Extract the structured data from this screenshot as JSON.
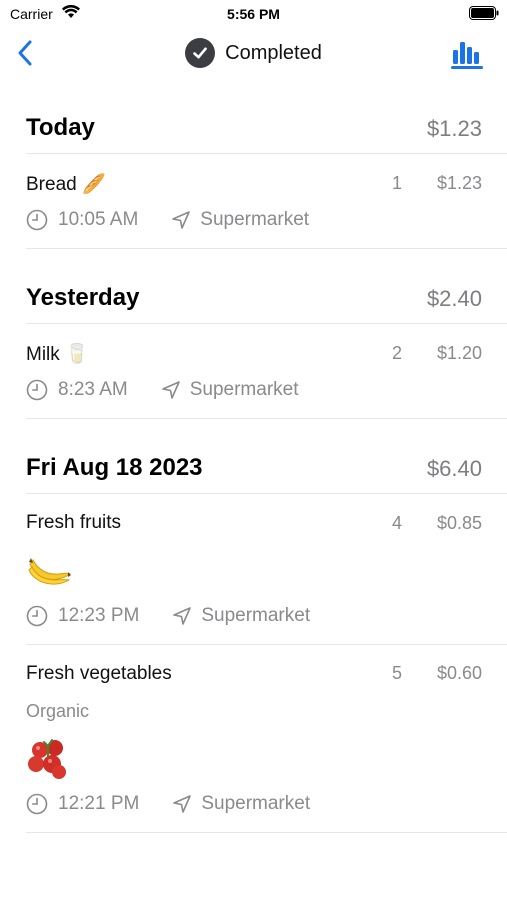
{
  "status": {
    "carrier": "Carrier",
    "time": "5:56 PM"
  },
  "nav": {
    "title": "Completed"
  },
  "sections": [
    {
      "title": "Today",
      "total": "$1.23",
      "items": [
        {
          "name": "Bread 🥖",
          "qty": "1",
          "price": "$1.23",
          "time": "10:05 AM",
          "location": "Supermarket"
        }
      ]
    },
    {
      "title": "Yesterday",
      "total": "$2.40",
      "items": [
        {
          "name": "Milk 🥛",
          "qty": "2",
          "price": "$1.20",
          "time": "8:23 AM",
          "location": "Supermarket"
        }
      ]
    },
    {
      "title": "Fri Aug 18 2023",
      "total": "$6.40",
      "items": [
        {
          "name": "Fresh fruits",
          "qty": "4",
          "price": "$0.85",
          "image": "banana-icon",
          "time": "12:23 PM",
          "location": "Supermarket"
        },
        {
          "name": "Fresh vegetables",
          "note": "Organic",
          "qty": "5",
          "price": "$0.60",
          "image": "tomato-icon",
          "time": "12:21 PM",
          "location": "Supermarket"
        }
      ]
    }
  ],
  "colors": {
    "accent": "#1a73e8",
    "secondary_text": "#8a8a8e",
    "divider": "#e5e5ea"
  }
}
